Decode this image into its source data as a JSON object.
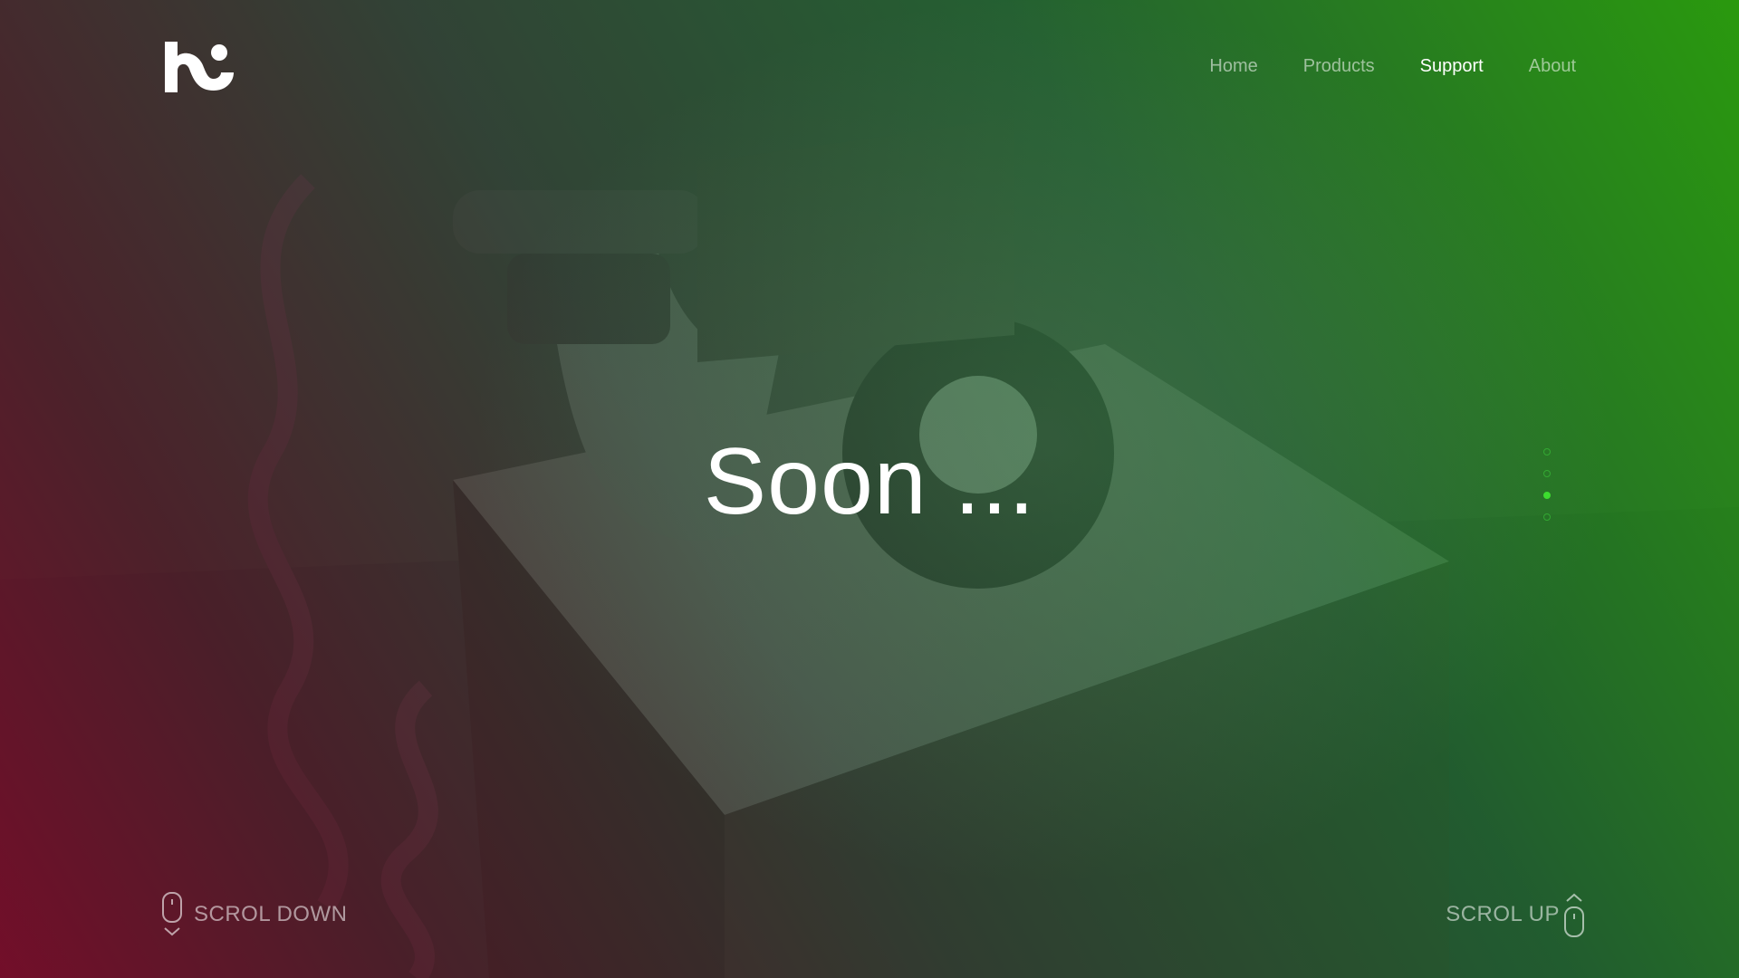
{
  "nav": {
    "items": [
      {
        "label": "Home",
        "active": false
      },
      {
        "label": "Products",
        "active": false
      },
      {
        "label": "Support",
        "active": true
      },
      {
        "label": "About",
        "active": false
      }
    ]
  },
  "hero": {
    "headline": "Soon ..."
  },
  "pager": {
    "count": 4,
    "active_index": 2
  },
  "footer": {
    "scroll_down_label": "SCROL DOWN",
    "scroll_up_label": "SCROL UP"
  },
  "colors": {
    "accent": "#3ddc2f",
    "gradient_left": "#780a28",
    "gradient_right": "#28a00a"
  },
  "icons": {
    "logo": "brand-logo",
    "scroll_down": "mouse-scroll-down-icon",
    "scroll_up": "mouse-scroll-up-icon"
  }
}
